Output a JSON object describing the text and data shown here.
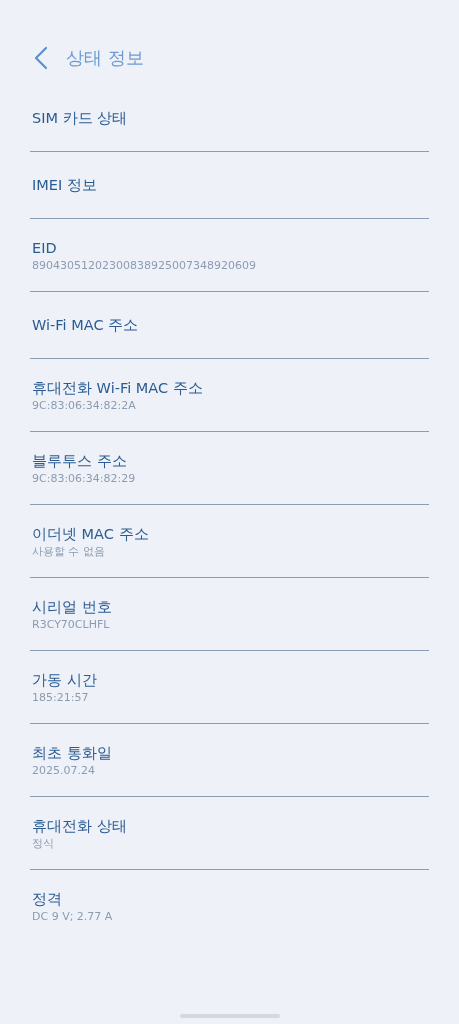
{
  "header": {
    "title": "상태 정보"
  },
  "items": [
    {
      "title": "SIM 카드 상태"
    },
    {
      "title": "IMEI 정보"
    },
    {
      "title": "EID",
      "value": "89043051202300838925007348920609"
    },
    {
      "title": "Wi-Fi MAC 주소"
    },
    {
      "title": "휴대전화 Wi-Fi MAC 주소",
      "value": "9C:83:06:34:82:2A"
    },
    {
      "title": "블루투스 주소",
      "value": "9C:83:06:34:82:29"
    },
    {
      "title": "이더넷 MAC 주소",
      "value": "사용할 수 없음"
    },
    {
      "title": "시리얼 번호",
      "value": "R3CY70CLHFL"
    },
    {
      "title": "가동 시간",
      "value": "185:21:57"
    },
    {
      "title": "최초 통화일",
      "value": "2025.07.24"
    },
    {
      "title": "휴대전화 상태",
      "value": "정식"
    },
    {
      "title": "정격",
      "value": "DC 9 V; 2.77 A"
    }
  ]
}
